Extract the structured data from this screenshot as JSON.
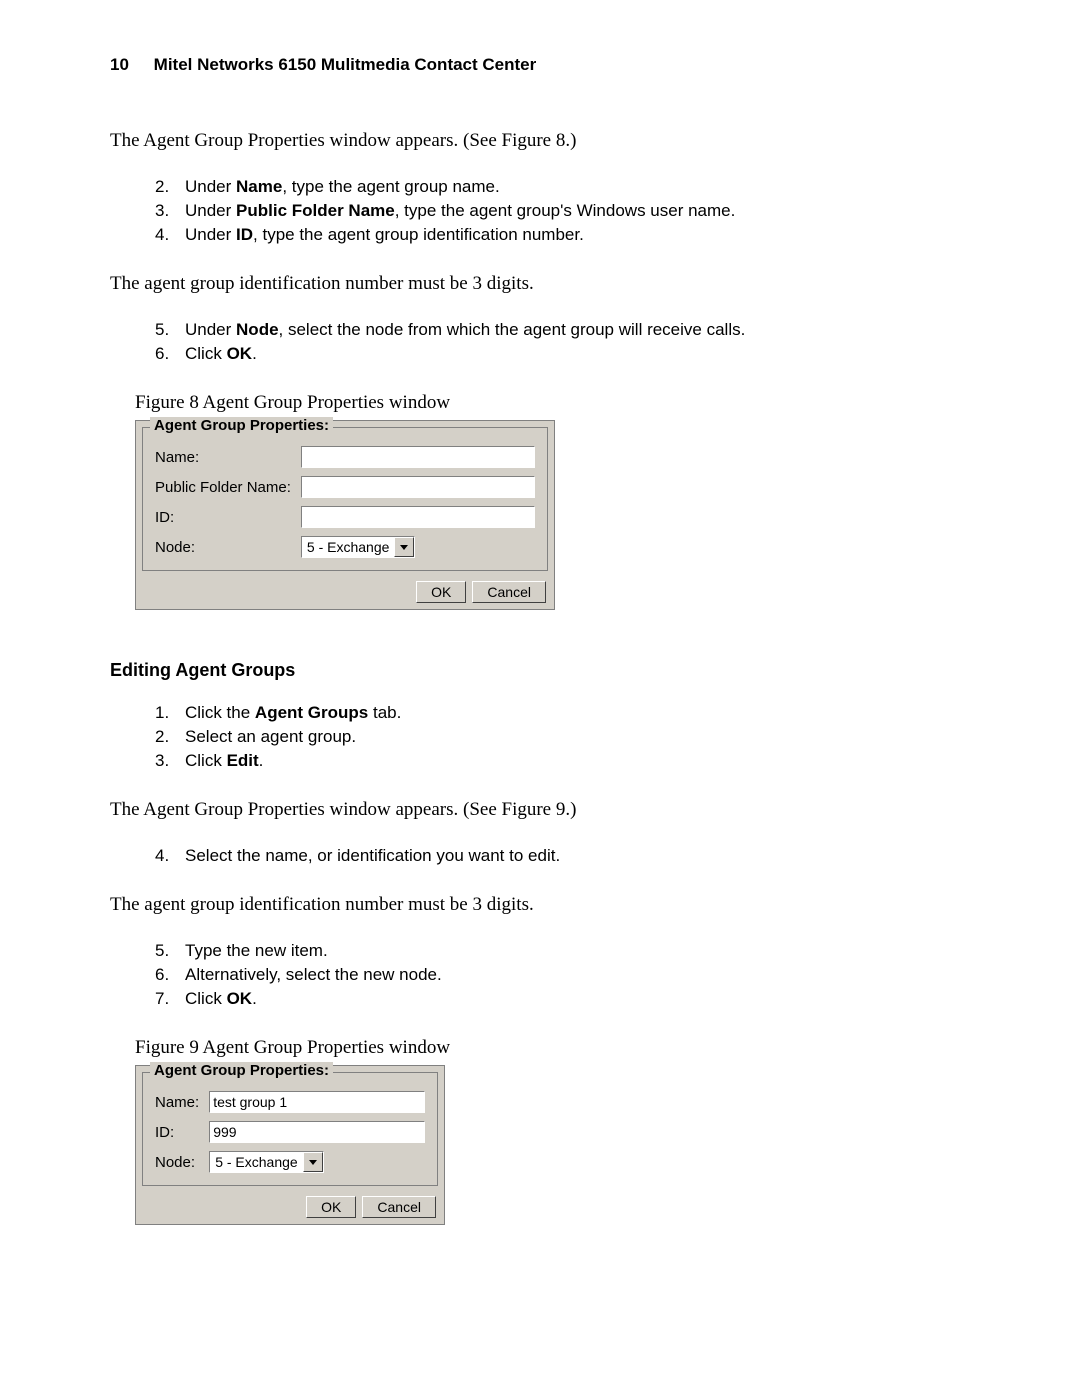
{
  "header": {
    "page_number": "10",
    "title": "Mitel Networks 6150 Mulitmedia Contact Center"
  },
  "intro1": "The Agent Group Properties window appears. (See Figure 8.)",
  "steps_a": [
    {
      "n": "2.",
      "pre": "Under ",
      "bold": "Name",
      "post": ", type the agent group name."
    },
    {
      "n": "3.",
      "pre": "Under ",
      "bold": "Public Folder Name",
      "post": ", type the agent group's Windows user name."
    },
    {
      "n": "4.",
      "pre": "Under ",
      "bold": "ID",
      "post": ", type the agent group identification number."
    }
  ],
  "note1": "The agent group identification number must be 3 digits.",
  "steps_b": [
    {
      "n": "5.",
      "pre": "Under ",
      "bold": "Node",
      "post": ", select the node from which the agent group will receive calls."
    },
    {
      "n": "6.",
      "pre": "Click ",
      "bold": "OK",
      "post": "."
    }
  ],
  "figure8": {
    "caption": "Figure 8   Agent Group Properties window",
    "legend": "Agent Group Properties:",
    "fields": {
      "name_label": "Name:",
      "pfn_label": "Public Folder Name:",
      "id_label": "ID:",
      "node_label": "Node:",
      "name_value": "",
      "pfn_value": "",
      "id_value": "",
      "node_value": "5 - Exchange"
    },
    "buttons": {
      "ok": "OK",
      "cancel": "Cancel"
    }
  },
  "section2_head": "Editing Agent Groups",
  "steps_c": [
    {
      "n": "1.",
      "pre": "Click the ",
      "bold": "Agent Groups",
      "post": " tab."
    },
    {
      "n": "2.",
      "pre": "Select an agent group.",
      "bold": "",
      "post": ""
    },
    {
      "n": "3.",
      "pre": "Click ",
      "bold": "Edit",
      "post": "."
    }
  ],
  "intro2": "The Agent Group Properties window appears. (See Figure 9.)",
  "steps_d": [
    {
      "n": "4.",
      "pre": "Select the name, or identification you want to edit.",
      "bold": "",
      "post": ""
    }
  ],
  "note2": "The agent group identification number must be 3 digits.",
  "steps_e": [
    {
      "n": "5.",
      "pre": "Type the new item.",
      "bold": "",
      "post": ""
    },
    {
      "n": "6.",
      "pre": "Alternatively, select the new node.",
      "bold": "",
      "post": ""
    },
    {
      "n": "7.",
      "pre": "Click ",
      "bold": "OK",
      "post": "."
    }
  ],
  "figure9": {
    "caption": "Figure 9   Agent Group Properties window",
    "legend": "Agent Group Properties:",
    "fields": {
      "name_label": "Name:",
      "id_label": "ID:",
      "node_label": "Node:",
      "name_value": "test group 1",
      "id_value": "999",
      "node_value": "5 - Exchange"
    },
    "buttons": {
      "ok": "OK",
      "cancel": "Cancel"
    }
  }
}
